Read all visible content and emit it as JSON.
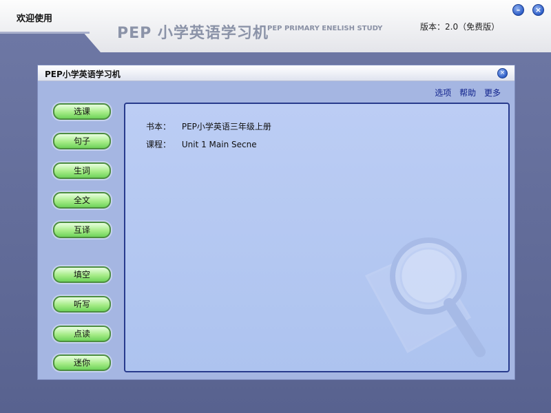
{
  "header": {
    "welcome": "欢迎使用",
    "logo": "PEP 小学英语学习机",
    "logo_sub": "PEP PRIMARY ENELISH STUDY",
    "version": "版本：2.0（免费版）",
    "minimize_icon": "minimize-icon",
    "close_icon": "close-icon"
  },
  "window": {
    "title": "PEP小学英语学习机",
    "menu": [
      "选项",
      "帮助",
      "更多"
    ],
    "buttons": [
      "选课",
      "句子",
      "生词",
      "全文",
      "互译",
      "填空",
      "听写",
      "点读",
      "迷你"
    ]
  },
  "content": {
    "book_label": "书本：",
    "book_value": "PEP小学英语三年级上册",
    "lesson_label": "课程：",
    "lesson_value": "Unit 1 Main Secne",
    "watermark_icon": "magnifier-icon"
  },
  "colors": {
    "accent_blue": "#2e5ec8",
    "panel_border": "#273a8c",
    "pill_green": "#a6ec88"
  }
}
